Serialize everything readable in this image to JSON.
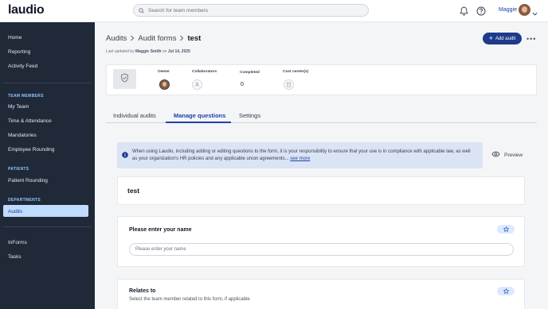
{
  "app": {
    "logo": "laudio"
  },
  "topbar": {
    "search_placeholder": "Search for team members",
    "username": "Maggie"
  },
  "sidebar": {
    "items_main": [
      "Home",
      "Reporting",
      "Activity Feed"
    ],
    "section_team": "TEAM MEMBERS",
    "items_team": [
      "My Team",
      "Time & Attendance",
      "Mandatories",
      "Employee Rounding"
    ],
    "section_patients": "PATIENTS",
    "items_patients": [
      "Patient Rounding"
    ],
    "section_departments": "DEPARTMENTS",
    "items_departments": [
      "Audits"
    ],
    "items_bottom": [
      "InForms",
      "Tasks"
    ]
  },
  "header": {
    "breadcrumb": [
      "Audits",
      "Audit forms",
      "test"
    ],
    "updated_prefix": "Last updated by",
    "updated_by": "Maggie Smith",
    "updated_on_word": "on",
    "updated_date": "Jul 14, 2025",
    "add_button": "Add audit"
  },
  "info": {
    "owner_label": "Owner",
    "collaborators_label": "Collaborators",
    "completed_label": "Completed",
    "completed_value": "0",
    "cost_center_label": "Cost center(s)"
  },
  "tabs": [
    "Individual audits",
    "Manage questions",
    "Settings"
  ],
  "active_tab": "Manage questions",
  "notice": {
    "text": "When using Laudio, including adding or editing questions to the form, it is your responsibility to ensure that your use is in compliance with applicable law, as well as your organization's HR policies and any applicable union agreements...",
    "link": "see more"
  },
  "preview_label": "Preview",
  "form": {
    "title": "test",
    "questions": [
      {
        "title": "Please enter your name",
        "placeholder": "Please enter your name"
      },
      {
        "title": "Relates to",
        "subtitle": "Select the team member related to this form, if applicable"
      }
    ]
  },
  "colors": {
    "sidebar_bg": "#1f2937",
    "accent": "#1e3a8a",
    "link": "#1e40af",
    "active_item_bg": "#bfdbfe",
    "notice_bg": "#dbe4f5"
  }
}
